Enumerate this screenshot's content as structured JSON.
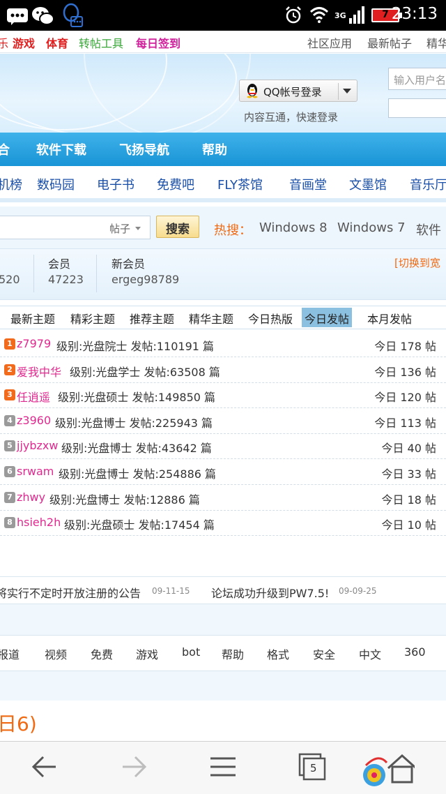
{
  "status_bar": {
    "time": "23:13",
    "network": "3G",
    "battery": "7",
    "icons": [
      "message-icon",
      "wechat-icon",
      "qq-icon",
      "alarm-icon",
      "wifi-icon",
      "signal-icon",
      "battery-icon"
    ]
  },
  "top_links": {
    "left": [
      "乐",
      "游戏",
      "体育",
      "转帖工具",
      "每日签到"
    ],
    "right": [
      "社区应用",
      "最新帖子",
      "精华"
    ]
  },
  "banner": {
    "qq_login": "QQ帐号登录",
    "qq_subtitle": "内容互通，快速登录",
    "username_placeholder": "输入用户名"
  },
  "main_nav": [
    "合",
    "软件下载",
    "飞扬导航",
    "帮助"
  ],
  "sub_nav": [
    "机榜",
    "数码园",
    "电子书",
    "免费吧",
    "FLY茶馆",
    "音画堂",
    "文墨馆",
    "音乐厅"
  ],
  "search": {
    "type": "帖子",
    "button": "搜索",
    "hot_label": "热搜：",
    "hot_items": [
      "Windows 8",
      "Windows 7",
      "软件"
    ]
  },
  "stats": {
    "partial_value": "520",
    "members_label": "会员",
    "members_value": "47223",
    "new_member_label": "新会员",
    "new_member_value": "ergeg98789",
    "switch_link": "[切换到宽"
  },
  "tabs": {
    "items": [
      "最新主题",
      "精彩主题",
      "推荐主题",
      "精华主题",
      "今日热版",
      "今日发帖",
      "本月发帖"
    ],
    "active": "今日发帖"
  },
  "ranking": [
    {
      "rank": "1",
      "name": "z7979",
      "info": "级别:光盘院士 发帖:110191 篇",
      "today": "今日 178 帖",
      "color": "#f26b1d"
    },
    {
      "rank": "2",
      "name": "爱我中华",
      "info": "级别:光盘学士 发帖:63508 篇",
      "today": "今日 136 帖",
      "color": "#f26b1d"
    },
    {
      "rank": "3",
      "name": "任逍遥",
      "info": "级别:光盘硕士 发帖:149850 篇",
      "today": "今日 120 帖",
      "color": "#f26b1d"
    },
    {
      "rank": "4",
      "name": "z3960",
      "info": "级别:光盘博士 发帖:225943 篇",
      "today": "今日 113 帖",
      "color": "#9a9a9a"
    },
    {
      "rank": "5",
      "name": "jjybzxw",
      "info": "级别:光盘博士 发帖:43642 篇",
      "today": "今日 40 帖",
      "color": "#9a9a9a"
    },
    {
      "rank": "6",
      "name": "srwam",
      "info": "级别:光盘博士 发帖:254886 篇",
      "today": "今日 33 帖",
      "color": "#9a9a9a"
    },
    {
      "rank": "7",
      "name": "zhwy",
      "info": "级别:光盘博士 发帖:12886 篇",
      "today": "今日 18 帖",
      "color": "#9a9a9a"
    },
    {
      "rank": "8",
      "name": "hsieh2h",
      "info": "级别:光盘硕士 发帖:17454 篇",
      "today": "今日 10 帖",
      "color": "#9a9a9a"
    }
  ],
  "announcements": [
    {
      "title": "将实行不定时开放注册的公告",
      "date": "09-11-15"
    },
    {
      "title": "论坛成功升级到PW7.5!",
      "date": "09-09-25"
    }
  ],
  "tags": [
    "报道",
    "视频",
    "免费",
    "游戏",
    "bot",
    "帮助",
    "格式",
    "安全",
    "中文",
    "360"
  ],
  "section_heading": "日6)",
  "browser_bar": {
    "tab_count": "5",
    "icons": [
      "back-arrow-icon",
      "forward-arrow-icon",
      "menu-icon",
      "tabs-icon",
      "home-icon"
    ]
  },
  "colors": {
    "nav_blue": "#1994d6",
    "link_blue": "#1a4fa8",
    "hot_orange": "#f06a13",
    "name_pink": "#e0298f",
    "red": "#e02020",
    "green": "#3aa63a",
    "magenta": "#d0209b"
  }
}
